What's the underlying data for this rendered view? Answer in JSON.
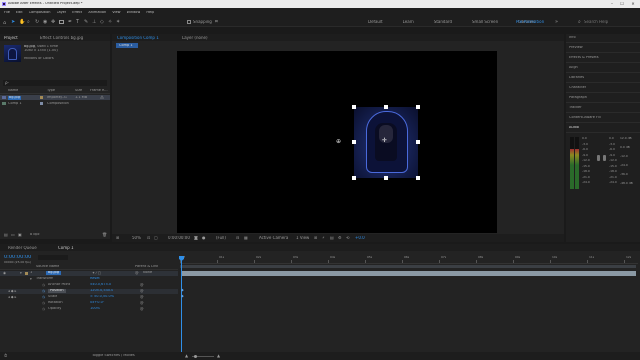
{
  "window": {
    "title": "Adobe After Effects - Untitled Project.aep *"
  },
  "menu": [
    "File",
    "Edit",
    "Composition",
    "Layer",
    "Effect",
    "Animation",
    "View",
    "Window",
    "Help"
  ],
  "toolbar": {
    "snapping_label": "Snapping",
    "workspaces": [
      "Default",
      "Learn",
      "Standard",
      "Small Screen",
      "Libraries"
    ],
    "active_workspace": "Pre-Animation",
    "search_placeholder": "Search Help"
  },
  "project_panel": {
    "tab_project": "Project",
    "tab_effect_controls": "Effect Controls bg.jpg",
    "selected_item_name": "bg.jpg",
    "selected_item_used": ", used 1 time",
    "selected_item_dims": "1080 x 1350 (1.00)",
    "selected_item_color": "Millions of Colors",
    "search_placeholder": "ρ-",
    "columns": [
      "Name",
      "Type",
      "Size",
      "Frame R..."
    ],
    "items": [
      {
        "name": "bg.jpg",
        "type": "ImporteJ..G",
        "size": "1.1 MB"
      },
      {
        "name": "Comp 1",
        "type": "Composition",
        "size": ""
      }
    ],
    "bpc": "8 bpc"
  },
  "composition_panel": {
    "tab": "Composition Comp 1",
    "layer_tab": "Layer (none)",
    "breadcrumb": "Comp 1",
    "zoom": "50%",
    "timecode": "0:00:00:00",
    "resolution": "(Full)",
    "camera": "Active Camera",
    "view": "1 View",
    "exposure": "+0.0"
  },
  "right_panels": [
    "Info",
    "Preview",
    "Effects & Presets",
    "Align",
    "Libraries",
    "Character",
    "Paragraph",
    "Tracker",
    "Content-Aware Fill",
    "Audio"
  ],
  "audio": {
    "left_scale": [
      "0.0",
      "-3.0",
      "-6.0",
      "-9.0",
      "-12.0",
      "-15.0",
      "-18.0",
      "-21.0",
      "-24.0"
    ],
    "mid_scale": [
      "0.0",
      "-3.0",
      "-6.0",
      "-9.0",
      "-12.0",
      "-15.0",
      "-18.0",
      "-21.0",
      "-24.0"
    ],
    "right_scale": [
      "12.0 dB",
      "0.0 dB",
      "-12.0",
      "-24.0",
      "-36.0",
      "-48.0 dB"
    ]
  },
  "timeline": {
    "tab_render": "Render Queue",
    "tab_comp": "Comp 1",
    "timecode": "0:00:00:00",
    "frame_info": "00000 (25.00 fps)",
    "col_source": "Source Name",
    "col_parent": "Parent & Link",
    "layer_num": "1",
    "layer_name": "bg.jpg",
    "parent": "None",
    "group": "Transform",
    "group_reset": "Reset",
    "properties": [
      {
        "name": "Anchor Point",
        "value": "540.0,675.0"
      },
      {
        "name": "Position",
        "value": "1205.0,540.0"
      },
      {
        "name": "Scale",
        "value": "∞ 50.0,50.0%"
      },
      {
        "name": "Rotation",
        "value": "0x+0.0°"
      },
      {
        "name": "Opacity",
        "value": "100%"
      }
    ],
    "ruler": [
      "0f",
      "01s",
      "02s",
      "03s",
      "04s",
      "05s",
      "06s",
      "07s",
      "08s",
      "09s",
      "10s",
      "11s",
      "12s"
    ],
    "footer": "Toggle Switches / Modes"
  },
  "colors": {
    "accent": "#2f8fe8",
    "keyframe_blue": "#5aa0e6",
    "layer_bar": "#8b99a4"
  }
}
